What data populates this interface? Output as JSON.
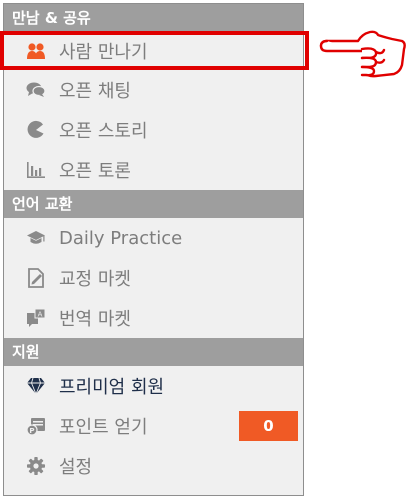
{
  "sections": [
    {
      "title": "만남 & 공유",
      "items": [
        {
          "label": "사람 만나기",
          "icon": "people-icon"
        },
        {
          "label": "오픈 채팅",
          "icon": "chat-bubbles-icon"
        },
        {
          "label": "오픈 스토리",
          "icon": "pacman-icon"
        },
        {
          "label": "오픈 토론",
          "icon": "bar-chart-icon"
        }
      ]
    },
    {
      "title": "언어 교환",
      "items": [
        {
          "label": "Daily Practice",
          "icon": "graduation-cap-icon"
        },
        {
          "label": "교정 마켓",
          "icon": "edit-document-icon"
        },
        {
          "label": "번역 마켓",
          "icon": "translate-icon"
        }
      ]
    },
    {
      "title": "지원",
      "items": [
        {
          "label": "프리미엄 회원",
          "icon": "diamond-icon"
        },
        {
          "label": "포인트 얻기",
          "icon": "coins-icon",
          "badge": "0"
        },
        {
          "label": "설정",
          "icon": "gear-icon"
        }
      ]
    }
  ],
  "colors": {
    "header_bg": "#9e9e9e",
    "menu_bg": "#f0f0f0",
    "accent_orange": "#f05a25",
    "highlight_red": "#e00000",
    "text_gray": "#7d7d7d",
    "text_dark": "#1f2f4a"
  }
}
